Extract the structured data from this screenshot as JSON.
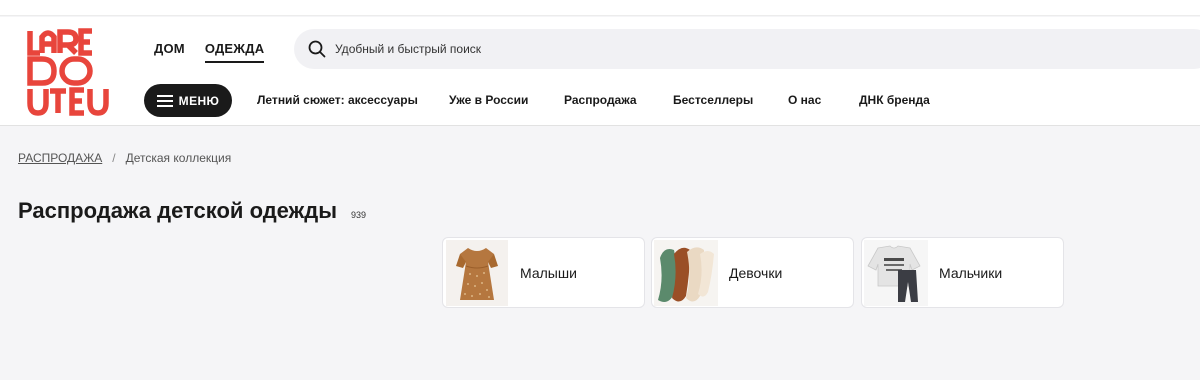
{
  "brand": {
    "name": "LA REDOUTE",
    "color": "#e8453c"
  },
  "universes": [
    {
      "label": "ДОМ",
      "active": false
    },
    {
      "label": "ОДЕЖДА",
      "active": true
    }
  ],
  "search": {
    "placeholder": "Удобный и быстрый поиск",
    "icon": "search-icon"
  },
  "menu_button": {
    "label": "МЕНЮ",
    "icon": "hamburger-icon"
  },
  "nav": [
    "Летний сюжет: аксессуары",
    "Уже в России",
    "Распродажа",
    "Бестселлеры",
    "О нас",
    "ДНК бренда"
  ],
  "breadcrumb": {
    "root": "РАСПРОДАЖА",
    "separator": "/",
    "current": "Детская коллекция"
  },
  "page": {
    "title": "Распродажа детской одежды",
    "count": "939"
  },
  "categories": [
    {
      "label": "Малыши",
      "thumb": "baby-dress-icon"
    },
    {
      "label": "Девочки",
      "thumb": "girls-tights-icon"
    },
    {
      "label": "Мальчики",
      "thumb": "boys-outfit-icon"
    }
  ]
}
